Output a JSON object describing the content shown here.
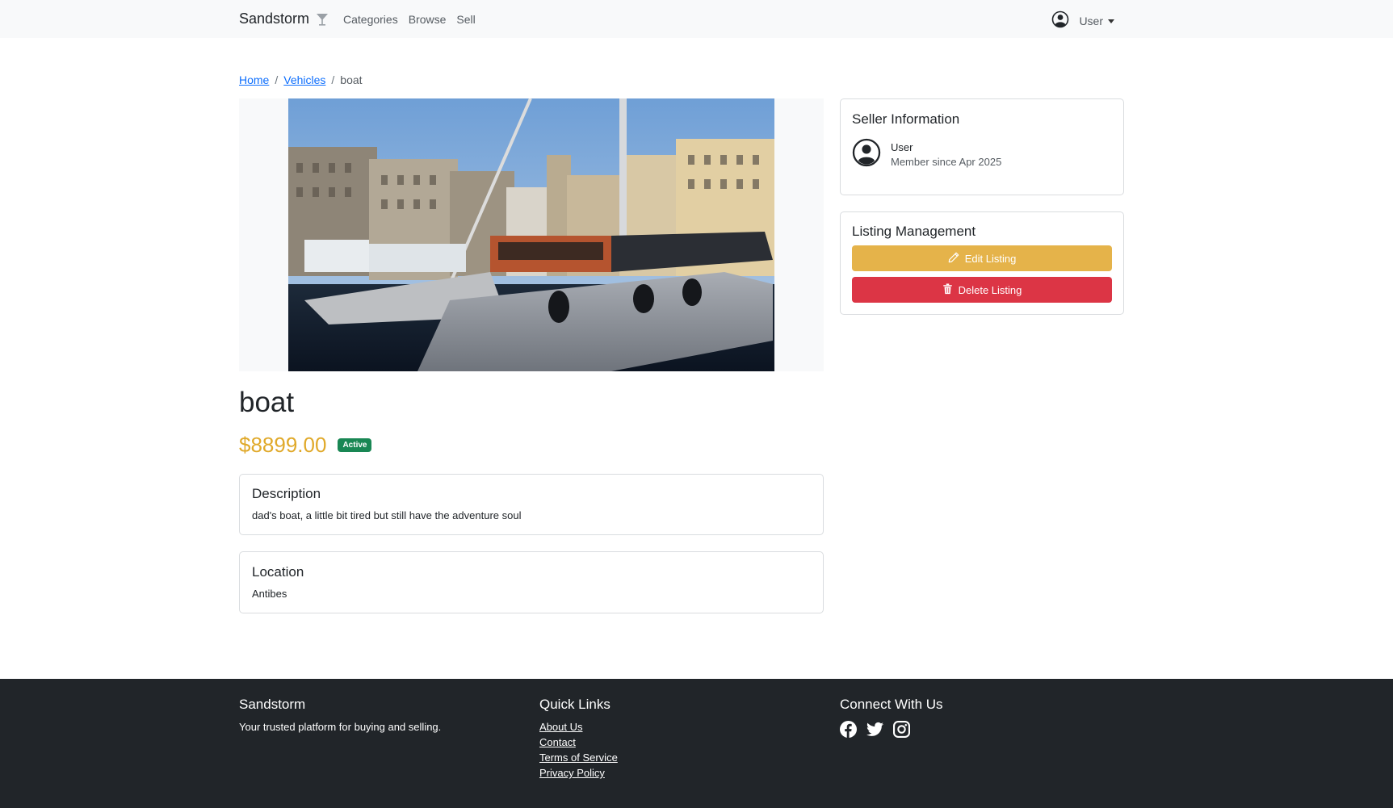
{
  "navbar": {
    "brand": "Sandstorm",
    "brand_icon": "martini-glass-icon",
    "links": [
      "Categories",
      "Browse",
      "Sell"
    ],
    "user_label": "User",
    "user_icon": "user-circle-icon"
  },
  "breadcrumb": {
    "home": "Home",
    "category": "Vehicles",
    "current": "boat",
    "separator": "/"
  },
  "listing": {
    "image_alt": "Catamaran boat docked in harbor",
    "title": "boat",
    "price": "$8899.00",
    "status": "Active",
    "description_title": "Description",
    "description": "dad's boat, a little bit tired but still have the adventure soul",
    "location_title": "Location",
    "location": "Antibes"
  },
  "seller": {
    "card_title": "Seller Information",
    "name": "User",
    "member_since": "Member since Apr 2025",
    "avatar_icon": "user-circle-icon"
  },
  "management": {
    "card_title": "Listing Management",
    "edit_label": "Edit Listing",
    "edit_icon": "pencil-icon",
    "delete_label": "Delete Listing",
    "delete_icon": "trash-icon"
  },
  "footer": {
    "brand": "Sandstorm",
    "tagline": "Your trusted platform for buying and selling.",
    "quick_links_title": "Quick Links",
    "quick_links": [
      "About Us",
      "Contact",
      "Terms of Service",
      "Privacy Policy"
    ],
    "connect_title": "Connect With Us",
    "social_icons": [
      "facebook-icon",
      "twitter-icon",
      "instagram-icon"
    ]
  },
  "colors": {
    "price": "#e0a92a",
    "badge": "#198754",
    "edit_button": "#e5b34a",
    "delete_button": "#dc3545",
    "footer_bg": "#212529",
    "navbar_bg": "#f8f9fa",
    "link": "#0d6efd"
  }
}
